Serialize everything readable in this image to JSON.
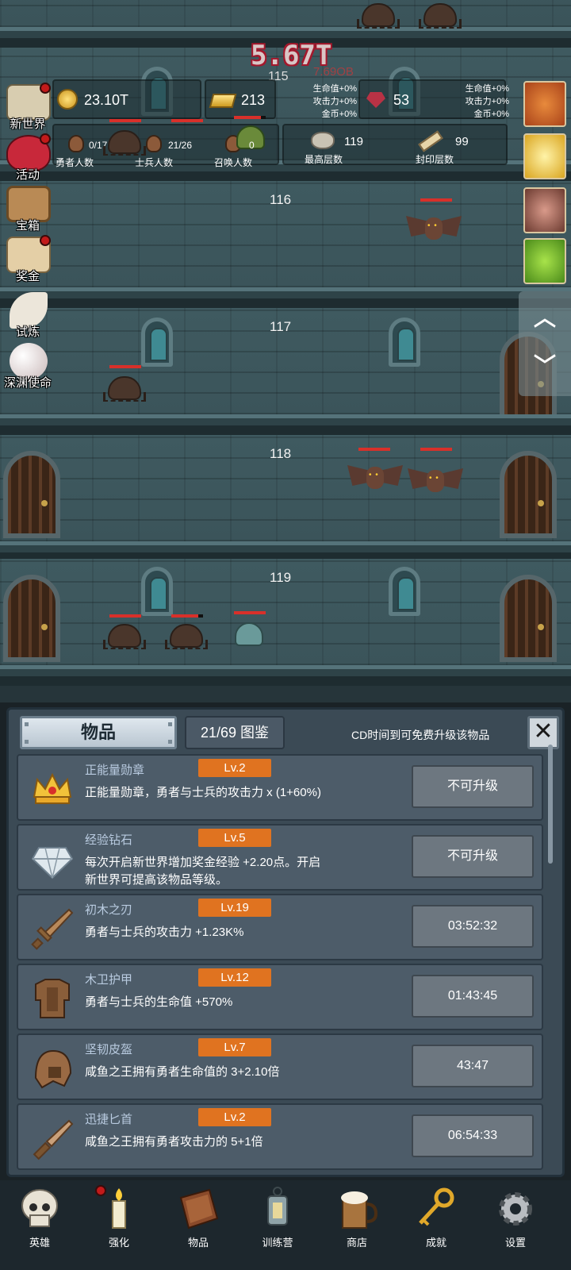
{
  "hud": {
    "big_damage": "5.67T",
    "damage_small": "7.69OB",
    "floor_top": "115",
    "gold": "23.10T",
    "gold_bars": "213",
    "gems": "53",
    "bonus_left": [
      "生命值+0%",
      "攻击力+0%",
      "金币+0%"
    ],
    "bonus_right": [
      "生命值+0%",
      "攻击力+0%",
      "金币+0%"
    ],
    "heroes_count": "0/17",
    "heroes_label": "勇者人数",
    "soldiers_count": "21/26",
    "soldiers_label": "士兵人数",
    "summons_count": "0",
    "summons_label": "召唤人数",
    "highest_floor": "119",
    "highest_floor_label": "最高层数",
    "sealed_floor": "99",
    "sealed_floor_label": "封印层数"
  },
  "side_menu": [
    {
      "label": "新世界",
      "icon": "map-icon",
      "dot": true
    },
    {
      "label": "活动",
      "icon": "heart-icon",
      "dot": true
    },
    {
      "label": "宝箱",
      "icon": "chest-icon",
      "dot": false
    },
    {
      "label": "奖金",
      "icon": "envelope-icon",
      "dot": true
    },
    {
      "label": "试炼",
      "icon": "feather-icon",
      "dot": false
    },
    {
      "label": "深渊使命",
      "icon": "pearl-icon",
      "dot": false
    }
  ],
  "floors": [
    "116",
    "117",
    "118",
    "119"
  ],
  "panel": {
    "title": "物品",
    "codex": "21/69 图鉴",
    "cd_note": "CD时间到可免费升级该物品",
    "close_icon": "close-icon",
    "items": [
      {
        "name": "正能量勋章",
        "level": "Lv.2",
        "desc": "正能量勋章，勇者与士兵的攻击力 x (1+60%)",
        "button": "不可升级",
        "icon": "crown-medal-icon"
      },
      {
        "name": "经验钻石",
        "level": "Lv.5",
        "desc": "每次开启新世界增加奖金经验 +2.20点。开启新世界可提高该物品等级。",
        "button": "不可升级",
        "icon": "diamond-icon"
      },
      {
        "name": "初木之刃",
        "level": "Lv.19",
        "desc": "勇者与士兵的攻击力 +1.23K%",
        "button": "03:52:32",
        "icon": "wooden-sword-icon"
      },
      {
        "name": "木卫护甲",
        "level": "Lv.12",
        "desc": "勇者与士兵的生命值 +570%",
        "button": "01:43:45",
        "icon": "armor-icon"
      },
      {
        "name": "坚韧皮盔",
        "level": "Lv.7",
        "desc": "咸鱼之王拥有勇者生命值的 3+2.10倍",
        "button": "43:47",
        "icon": "leather-helmet-icon"
      },
      {
        "name": "迅捷匕首",
        "level": "Lv.2",
        "desc": "咸鱼之王拥有勇者攻击力的 5+1倍",
        "button": "06:54:33",
        "icon": "dagger-icon"
      }
    ]
  },
  "bottom_nav": [
    {
      "label": "英雄",
      "icon": "skull-icon",
      "dot": false
    },
    {
      "label": "强化",
      "icon": "candle-icon",
      "dot": true
    },
    {
      "label": "物品",
      "icon": "book-icon",
      "dot": false
    },
    {
      "label": "训练营",
      "icon": "lantern-icon",
      "dot": false
    },
    {
      "label": "商店",
      "icon": "beer-mug-icon",
      "dot": false
    },
    {
      "label": "成就",
      "icon": "key-icon",
      "dot": false
    },
    {
      "label": "设置",
      "icon": "gear-icon",
      "dot": false
    }
  ],
  "colors": {
    "level_badge": "#e07320",
    "hp_bar": "#d8302a",
    "panel_bg": "#3b4a55",
    "name_text": "#b9cbe0"
  }
}
